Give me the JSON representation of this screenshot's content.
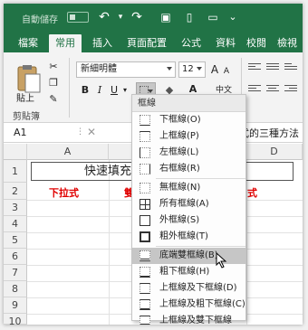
{
  "qat": {
    "autosave_label": "自動儲存",
    "undo": "↶",
    "redo": "↷",
    "save": "▣",
    "open": "▭",
    "more": "⌄"
  },
  "tabs": [
    {
      "label": "檔案"
    },
    {
      "label": "常用"
    },
    {
      "label": "插入"
    },
    {
      "label": "頁面配置"
    },
    {
      "label": "公式"
    },
    {
      "label": "資料"
    },
    {
      "label": "校閱"
    },
    {
      "label": "檢視"
    }
  ],
  "ribbon": {
    "paste_label": "貼上",
    "clipboard_group": "剪貼簿",
    "font_name": "新細明體",
    "font_size": "12",
    "bold": "B",
    "italic": "I",
    "underline": "U",
    "grow_font": "A",
    "shrink_font": "A",
    "font_color": "A",
    "phonetic": "中文"
  },
  "formula_bar": {
    "name_box": "A1",
    "formula_fragment": "式的三種方法"
  },
  "grid": {
    "columns": [
      "A",
      "D"
    ],
    "rows": [
      "1",
      "2",
      "3",
      "4",
      "5",
      "6",
      "7",
      "8",
      "9",
      "10"
    ],
    "a1_text": "快速填充公",
    "a2_text": "下拉式",
    "b2_fragment": "雙",
    "c2_fragment": "式"
  },
  "border_menu": {
    "header": "框線",
    "items": [
      {
        "label": "下框線(O)",
        "icon": "bottom-border-icon"
      },
      {
        "label": "上框線(P)",
        "icon": "top-border-icon"
      },
      {
        "label": "左框線(L)",
        "icon": "left-border-icon"
      },
      {
        "label": "右框線(R)",
        "icon": "right-border-icon"
      },
      {
        "label": "無框線(N)",
        "icon": "no-border-icon"
      },
      {
        "label": "所有框線(A)",
        "icon": "all-borders-icon"
      },
      {
        "label": "外框線(S)",
        "icon": "outside-borders-icon"
      },
      {
        "label": "粗外框線(T)",
        "icon": "thick-box-border-icon"
      },
      {
        "label": "底端雙框線(B)",
        "icon": "bottom-double-border-icon"
      },
      {
        "label": "粗下框線(H)",
        "icon": "thick-bottom-border-icon"
      },
      {
        "label": "上框線及下框線(D)",
        "icon": "top-bottom-border-icon"
      },
      {
        "label": "上框線及粗下框線(C)",
        "icon": "top-thick-bottom-border-icon"
      },
      {
        "label": "上框線及雙下框線(U)",
        "icon": "top-double-bottom-border-icon"
      }
    ],
    "highlighted_index": 8
  },
  "colors": {
    "excel_green": "#217346",
    "red_text": "#e00000"
  }
}
